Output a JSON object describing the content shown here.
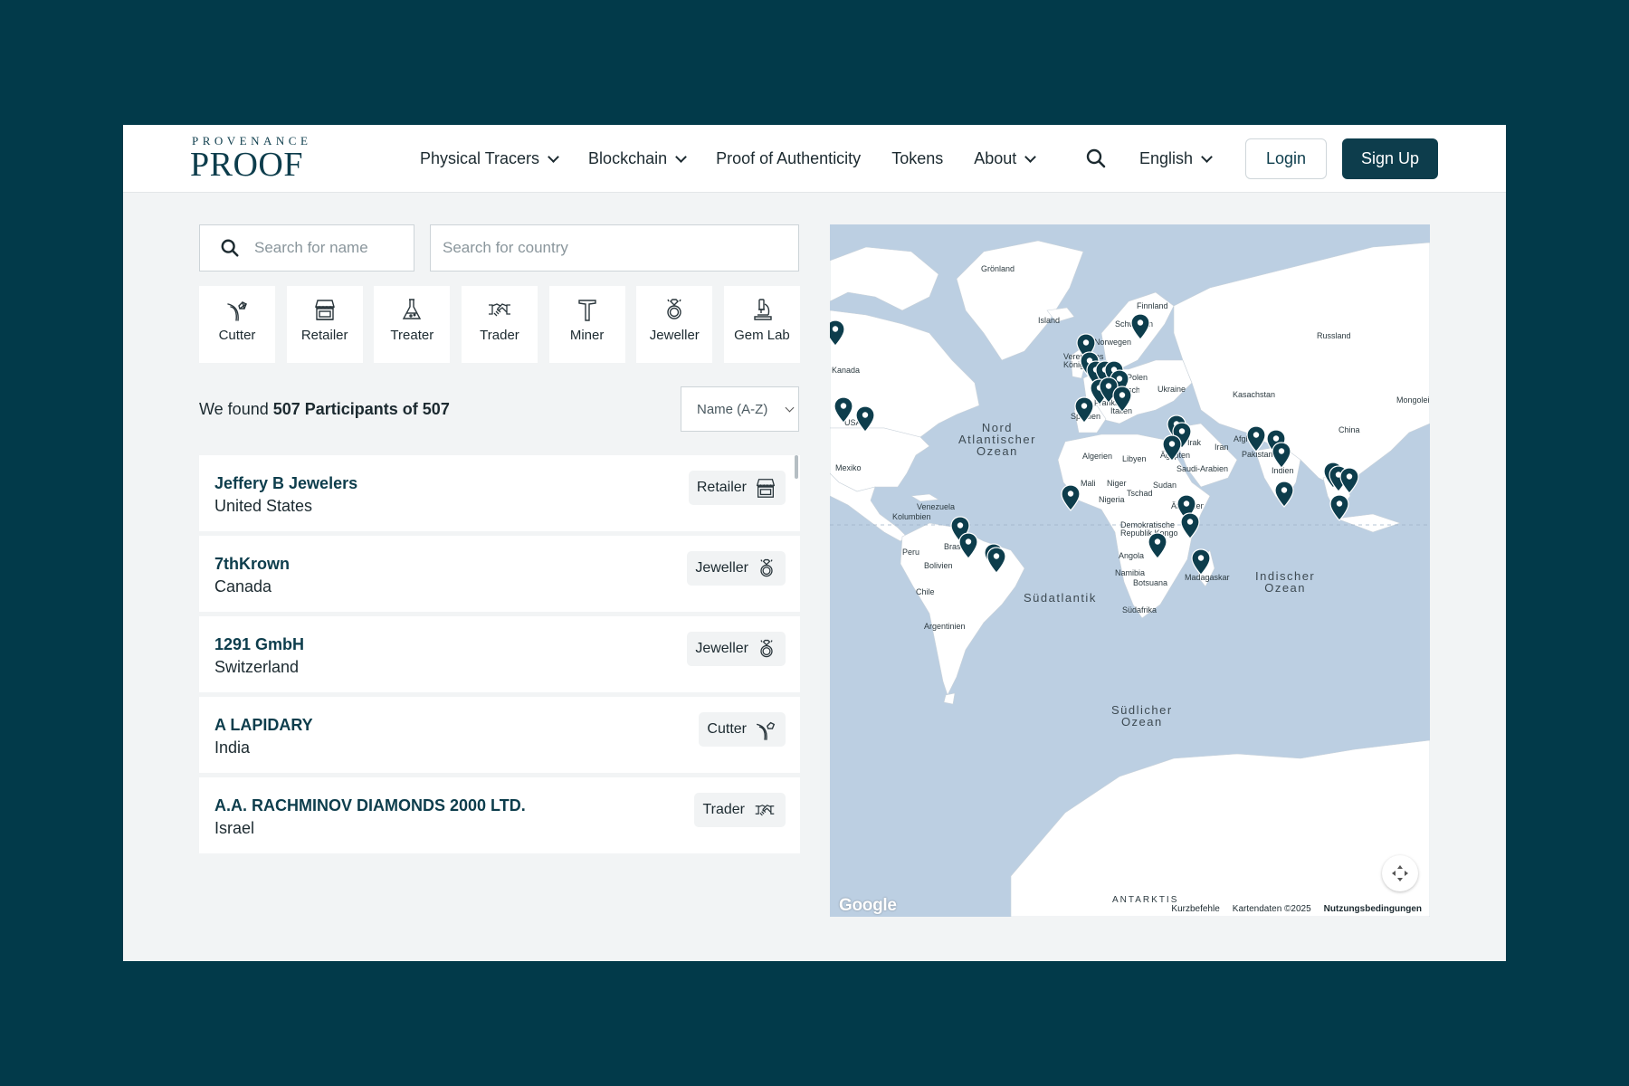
{
  "header": {
    "logo_top": "PROVENANCE",
    "logo_main": "PROOF",
    "nav": [
      {
        "label": "Physical Tracers",
        "dropdown": true
      },
      {
        "label": "Blockchain",
        "dropdown": true
      },
      {
        "label": "Proof of Authenticity",
        "dropdown": false
      },
      {
        "label": "Tokens",
        "dropdown": false
      },
      {
        "label": "About",
        "dropdown": true
      }
    ],
    "language": "English",
    "login": "Login",
    "signup": "Sign Up",
    "brand_color": "#0d3d4c"
  },
  "filters": {
    "name_placeholder": "Search for name",
    "country_placeholder": "Search for country",
    "roles": [
      {
        "label": "Cutter",
        "icon": "cutter-icon"
      },
      {
        "label": "Retailer",
        "icon": "store-icon"
      },
      {
        "label": "Treater",
        "icon": "flask-icon"
      },
      {
        "label": "Trader",
        "icon": "handshake-icon"
      },
      {
        "label": "Miner",
        "icon": "hammer-icon"
      },
      {
        "label": "Jeweller",
        "icon": "ring-icon"
      },
      {
        "label": "Gem Lab",
        "icon": "microscope-icon"
      }
    ]
  },
  "results": {
    "prefix": "We found ",
    "count_text": "507 Participants of 507",
    "sort": "Name (A-Z)",
    "items": [
      {
        "name": "Jeffery B Jewelers",
        "country": "United States",
        "role": "Retailer",
        "icon": "store-icon"
      },
      {
        "name": "7thKrown",
        "country": "Canada",
        "role": "Jeweller",
        "icon": "ring-icon"
      },
      {
        "name": "1291 GmbH",
        "country": "Switzerland",
        "role": "Jeweller",
        "icon": "ring-icon"
      },
      {
        "name": "A LAPIDARY",
        "country": "India",
        "role": "Cutter",
        "icon": "cutter-icon"
      },
      {
        "name": "A.A. RACHMINOV DIAMONDS 2000 LTD.",
        "country": "Israel",
        "role": "Trader",
        "icon": "handshake-icon"
      }
    ]
  },
  "map": {
    "labels": {
      "gronland": "Grönland",
      "island": "Island",
      "finnland": "Finnland",
      "schweden": "Schweden",
      "norwegen": "Norwegen",
      "russland": "Russland",
      "kanada": "Kanada",
      "usa": "USA",
      "vereinigtes": "Vereinigtes Königreich",
      "polen": "Polen",
      "ukraine": "Ukraine",
      "kasachstan": "Kasachstan",
      "mongolei": "Mongolei",
      "deutschland": "Deutschland",
      "frankreich": "Frankreich",
      "italien": "Italien",
      "spanien": "Spanien",
      "china": "China",
      "irak": "Irak",
      "iran": "Iran",
      "afghanistan": "Afghanistan",
      "pakistan": "Pakistan",
      "indien": "Indien",
      "mexiko": "Mexiko",
      "algerien": "Algerien",
      "libyen": "Libyen",
      "agypten": "Ägypten",
      "saudi": "Saudi-Arabien",
      "mali": "Mali",
      "niger": "Niger",
      "sudan": "Sudan",
      "tschad": "Tschad",
      "nigeria": "Nigeria",
      "athiopien": "Äthiopien",
      "venezuela": "Venezuela",
      "kolumbien": "Kolumbien",
      "demokratische": "Demokratische Republik Kongo",
      "peru": "Peru",
      "brasilien": "Brasilien",
      "bolivien": "Bolivien",
      "angola": "Angola",
      "namibia": "Namibia",
      "botsuana": "Botsuana",
      "madagaskar": "Madagaskar",
      "chile": "Chile",
      "sudafrika": "Südafrika",
      "argentinien": "Argentinien",
      "antarktis": "ANTARKTIS"
    },
    "oceans": {
      "nordatlantik": "Nord\nAtlantischer\nOzean",
      "sudatlantik": "Südatlantik",
      "indischer": "Indischer\nOzean",
      "sudlicher": "Südlicher\nOzean"
    },
    "google": "Google",
    "shortcuts": "Kurzbefehle",
    "mapdata": "Kartendaten ©2025",
    "terms": "Nutzungsbedingungen",
    "pin_color": "#0d3d4c"
  }
}
